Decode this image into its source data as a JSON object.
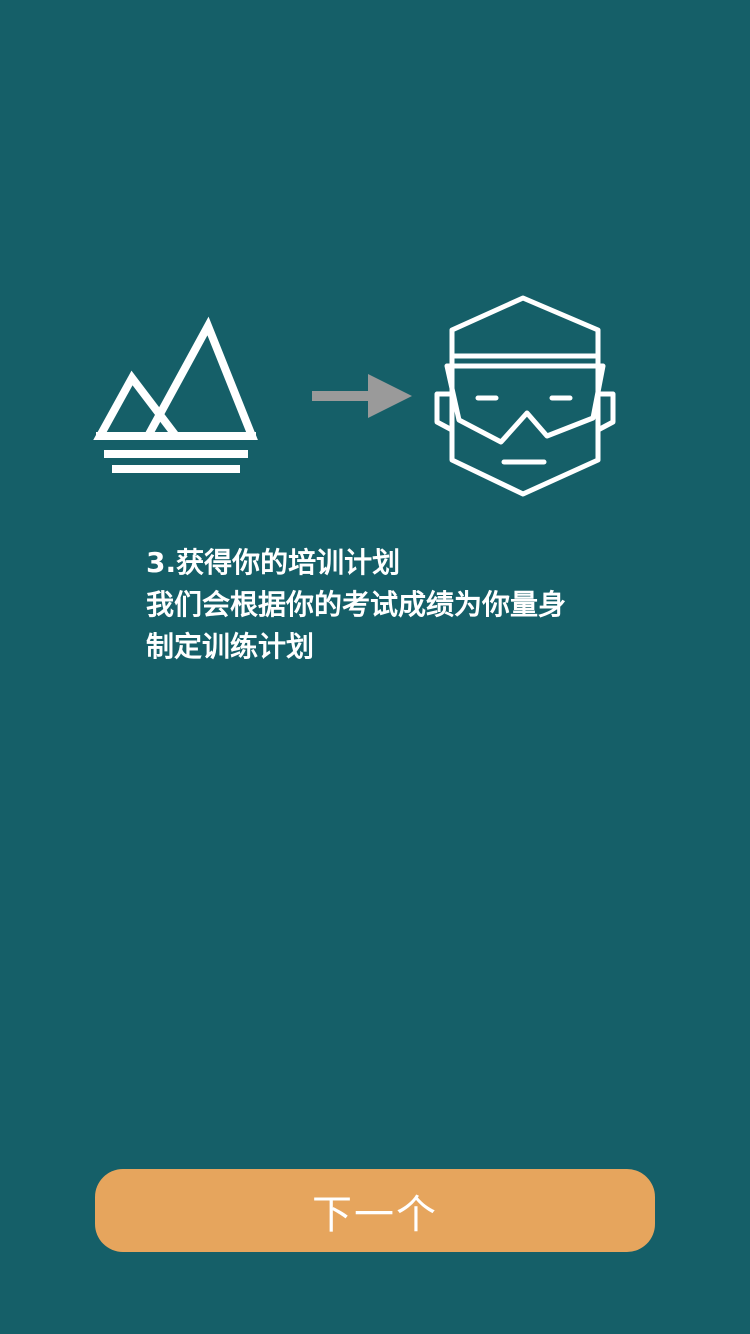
{
  "step": {
    "title": "3.获得你的培训计划",
    "description_line1": "我们会根据你的考试成绩为你量身",
    "description_line2": "制定训练计划"
  },
  "button": {
    "next_label": "下一个"
  },
  "illustration": {
    "source_icon": "mountain-icon",
    "arrow_icon": "arrow-right-icon",
    "target_icon": "trainer-face-icon"
  },
  "colors": {
    "background": "#155f68",
    "button": "#e6a55d",
    "icon_stroke": "#ffffff",
    "arrow": "#9a9a9a"
  }
}
